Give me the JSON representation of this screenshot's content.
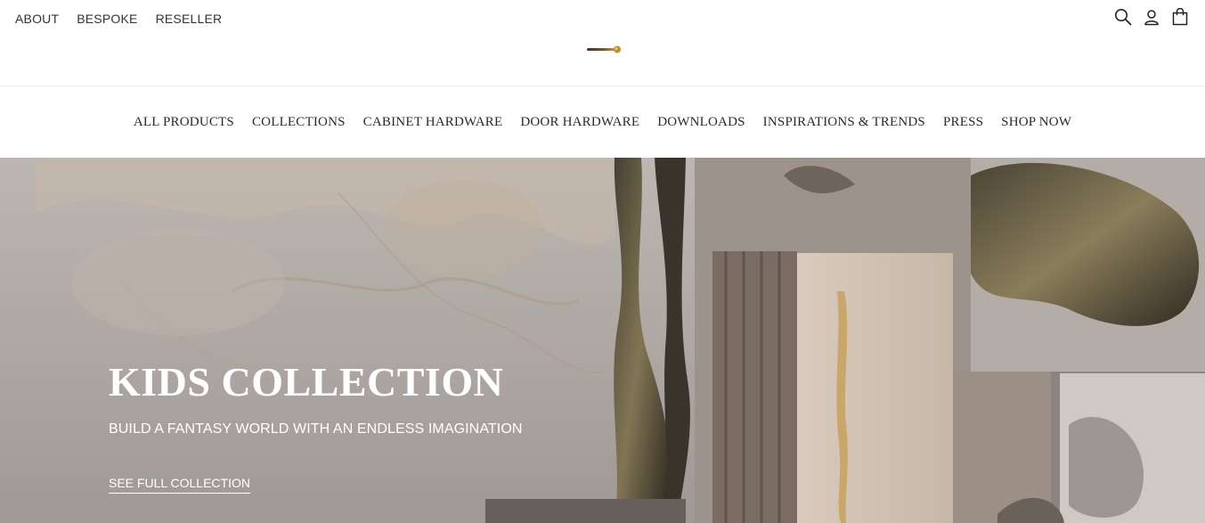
{
  "top_links": [
    "ABOUT",
    "BESPOKE",
    "RESELLER"
  ],
  "icons": {
    "search": "search-icon",
    "account": "user-icon",
    "cart": "shopping-bag-icon"
  },
  "nav": [
    "ALL PRODUCTS",
    "COLLECTIONS",
    "CABINET HARDWARE",
    "DOOR HARDWARE",
    "DOWNLOADS",
    "INSPIRATIONS & TRENDS",
    "PRESS",
    "SHOP NOW"
  ],
  "hero": {
    "title": "KIDS COLLECTION",
    "subtitle": "BUILD A FANTASY WORLD WITH AN ENDLESS IMAGINATION",
    "cta": "SEE FULL COLLECTION"
  },
  "colors": {
    "hero_text": "#ffffff",
    "nav_text": "#2a2a2a",
    "logo_gold": "#b8923a"
  }
}
